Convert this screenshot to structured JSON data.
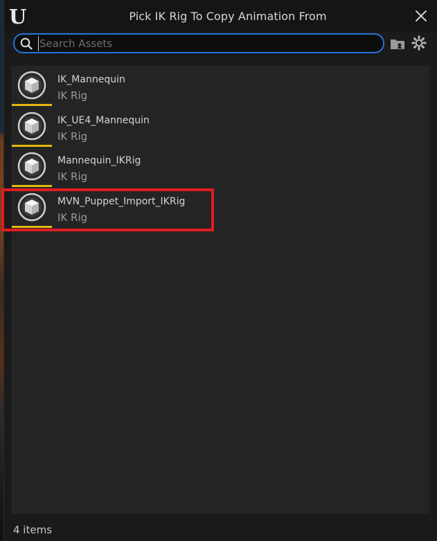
{
  "window": {
    "title": "Pick IK Rig To Copy Animation From",
    "icons": {
      "logo": "unreal-engine-logo",
      "close": "close-icon"
    }
  },
  "search": {
    "placeholder": "Search Assets",
    "value": "",
    "icon": "search-icon"
  },
  "toolbar": {
    "folder_icon": "folder-icon",
    "settings_icon": "gear-icon"
  },
  "assets": [
    {
      "name": "IK_Mannequin",
      "type": "IK Rig",
      "icon": "ik-rig-cube-icon"
    },
    {
      "name": "IK_UE4_Mannequin",
      "type": "IK Rig",
      "icon": "ik-rig-cube-icon"
    },
    {
      "name": "Mannequin_IKRig",
      "type": "IK Rig",
      "icon": "ik-rig-cube-icon"
    },
    {
      "name": "MVN_Puppet_Import_IKRig",
      "type": "IK Rig",
      "icon": "ik-rig-cube-icon"
    }
  ],
  "status": {
    "item_count": "4 items"
  },
  "colors": {
    "accent_blue": "#2674d8",
    "asset_bar_yellow": "#e5b510",
    "highlight_red": "#e01d20",
    "background": "#1a1a1a",
    "list_background": "#242424"
  }
}
